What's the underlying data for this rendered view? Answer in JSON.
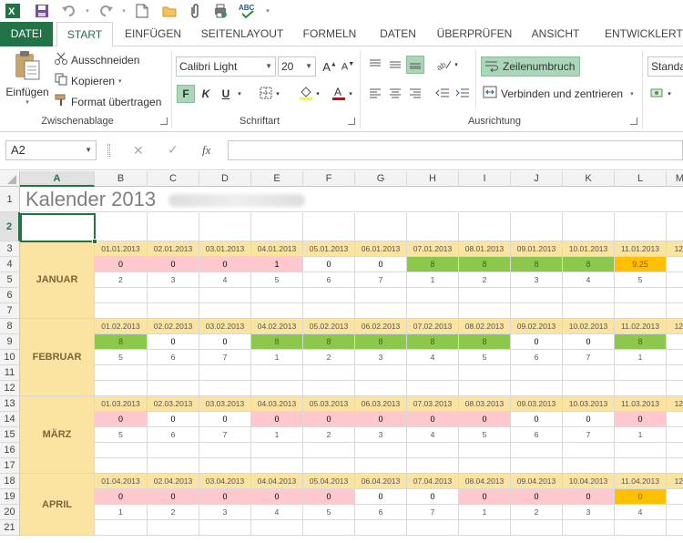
{
  "ribbon_tabs": [
    "DATEI",
    "START",
    "EINFÜGEN",
    "SEITENLAYOUT",
    "FORMELN",
    "DATEN",
    "ÜBERPRÜFEN",
    "ANSICHT",
    "ENTWICKLERTO"
  ],
  "clipboard": {
    "paste": "Einfügen",
    "cut": "Ausschneiden",
    "copy": "Kopieren",
    "format_painter": "Format übertragen",
    "label": "Zwischenablage"
  },
  "font": {
    "name": "Calibri Light",
    "size": "20",
    "bold": "F",
    "italic": "K",
    "underline": "U",
    "label": "Schriftart"
  },
  "alignment": {
    "wrap": "Zeilenumbruch",
    "merge": "Verbinden und zentrieren",
    "label": "Ausrichtung"
  },
  "number_format": "Standa",
  "namebox": "A2",
  "formula_fx": "fx",
  "columns": [
    "A",
    "B",
    "C",
    "D",
    "E",
    "F",
    "G",
    "H",
    "I",
    "J",
    "K",
    "L",
    "M"
  ],
  "sheet_title": "Kalender 2013",
  "months": [
    {
      "name": "JANUAR",
      "dates": [
        "01.01.2013",
        "02.01.2013",
        "03.01.2013",
        "04.01.2013",
        "05.01.2013",
        "06.01.2013",
        "07.01.2013",
        "08.01.2013",
        "09.01.2013",
        "10.01.2013",
        "11.01.2013",
        "12."
      ],
      "values": [
        "0",
        "0",
        "0",
        "1",
        "0",
        "0",
        "8",
        "8",
        "8",
        "8",
        "9.25",
        ""
      ],
      "styles": [
        "red",
        "red",
        "red",
        "red",
        "w",
        "w",
        "grn",
        "grn",
        "grn",
        "grn",
        "org",
        "w"
      ],
      "weekdays": [
        "2",
        "3",
        "4",
        "5",
        "6",
        "7",
        "1",
        "2",
        "3",
        "4",
        "5",
        ""
      ]
    },
    {
      "name": "FEBRUAR",
      "dates": [
        "01.02.2013",
        "02.02.2013",
        "03.02.2013",
        "04.02.2013",
        "05.02.2013",
        "06.02.2013",
        "07.02.2013",
        "08.02.2013",
        "09.02.2013",
        "10.02.2013",
        "11.02.2013",
        "12."
      ],
      "values": [
        "8",
        "0",
        "0",
        "8",
        "8",
        "8",
        "8",
        "8",
        "0",
        "0",
        "8",
        ""
      ],
      "styles": [
        "grn",
        "w",
        "w",
        "grn",
        "grn",
        "grn",
        "grn",
        "grn",
        "w",
        "w",
        "grn",
        "w"
      ],
      "weekdays": [
        "5",
        "6",
        "7",
        "1",
        "2",
        "3",
        "4",
        "5",
        "6",
        "7",
        "1",
        ""
      ]
    },
    {
      "name": "MÄRZ",
      "dates": [
        "01.03.2013",
        "02.03.2013",
        "03.03.2013",
        "04.03.2013",
        "05.03.2013",
        "06.03.2013",
        "07.03.2013",
        "08.03.2013",
        "09.03.2013",
        "10.03.2013",
        "11.03.2013",
        "12."
      ],
      "values": [
        "0",
        "0",
        "0",
        "0",
        "0",
        "0",
        "0",
        "0",
        "0",
        "0",
        "0",
        ""
      ],
      "styles": [
        "red",
        "w",
        "w",
        "red",
        "red",
        "red",
        "red",
        "red",
        "w",
        "w",
        "red",
        "w"
      ],
      "weekdays": [
        "5",
        "6",
        "7",
        "1",
        "2",
        "3",
        "4",
        "5",
        "6",
        "7",
        "1",
        ""
      ]
    },
    {
      "name": "APRIL",
      "dates": [
        "01.04.2013",
        "02.04.2013",
        "03.04.2013",
        "04.04.2013",
        "05.04.2013",
        "06.04.2013",
        "07.04.2013",
        "08.04.2013",
        "09.04.2013",
        "10.04.2013",
        "11.04.2013",
        "12."
      ],
      "values": [
        "0",
        "0",
        "0",
        "0",
        "0",
        "0",
        "0",
        "0",
        "0",
        "0",
        "0",
        ""
      ],
      "styles": [
        "red",
        "red",
        "red",
        "red",
        "red",
        "w",
        "w",
        "red",
        "red",
        "red",
        "org",
        "w"
      ],
      "weekdays": [
        "1",
        "2",
        "3",
        "4",
        "5",
        "6",
        "7",
        "1",
        "2",
        "3",
        "4",
        ""
      ]
    }
  ],
  "colors": {
    "accent": "#217346",
    "date_fill": "#fbe3a2",
    "red_fill": "#ffc7ce",
    "green_fill": "#8cc84b",
    "orange_fill": "#ffc000"
  },
  "icons": [
    "excel-icon",
    "save-icon",
    "undo-icon",
    "redo-icon",
    "new-file-icon",
    "open-folder-icon",
    "attach-icon",
    "print-preview-icon",
    "spelling-icon",
    "scissors-icon",
    "copy-icon",
    "format-painter-icon",
    "paste-icon"
  ]
}
